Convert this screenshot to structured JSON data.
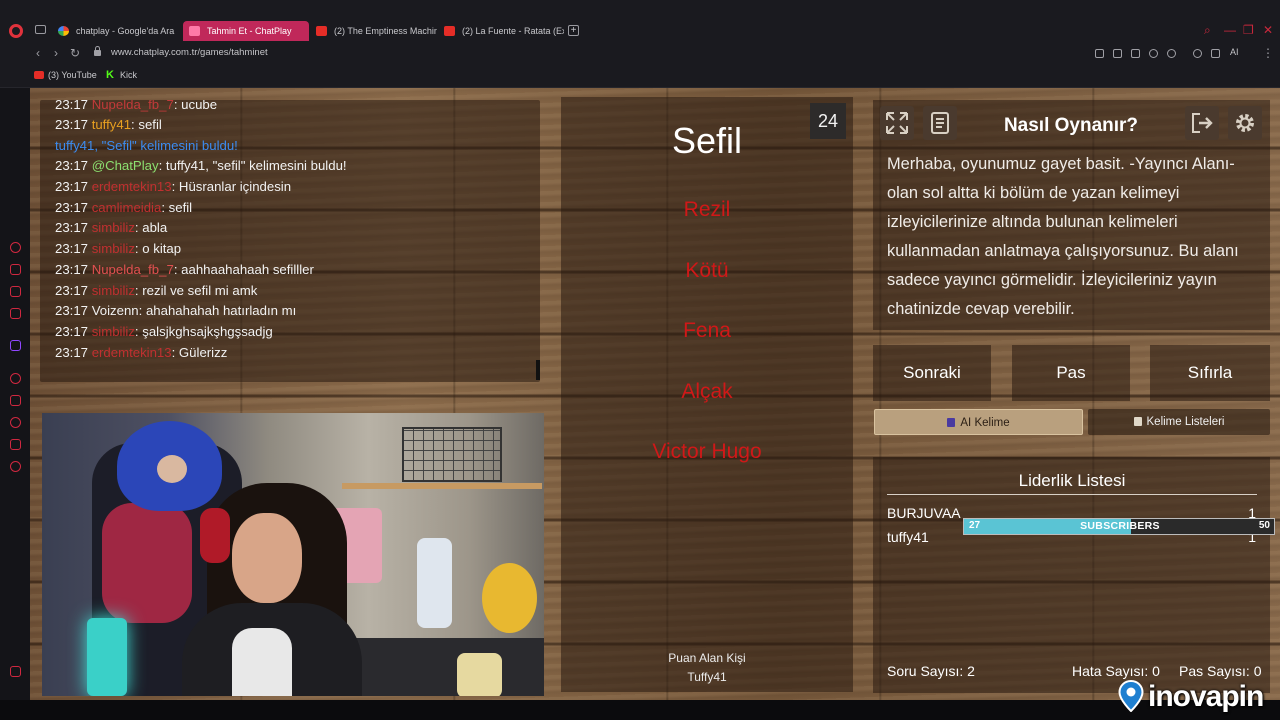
{
  "browser": {
    "tabs": [
      {
        "label": "chatplay - Google'da Ara",
        "favicon": "google-icon",
        "active": false
      },
      {
        "label": "Tahmin Et - ChatPlay",
        "favicon": "chatplay-icon",
        "active": true
      },
      {
        "label": "(2) The Emptiness Machin",
        "favicon": "youtube-icon",
        "active": false
      },
      {
        "label": "(2) La Fuente - Ratata (Ext",
        "favicon": "youtube-icon",
        "active": false
      }
    ],
    "new_tab": "+",
    "url": "www.chatplay.com.tr/games/tahminet",
    "ai_label": "AI",
    "bookmarks": [
      {
        "label": "(3) YouTube"
      },
      {
        "label": "Kick"
      }
    ],
    "colors": {
      "active_tab": "#c0285a",
      "sidebar_accent": "#d02840"
    }
  },
  "chat": {
    "messages": [
      {
        "time": "23:17",
        "user": "Nupelda_fb_7",
        "sep": ": ",
        "text": "ucube",
        "user_color": "#c23a3a"
      },
      {
        "time": "23:17",
        "user": "tuffy41",
        "sep": ": ",
        "text": "sefil",
        "user_color": "#e8a020"
      },
      {
        "time": "",
        "user": "",
        "sep": "",
        "text": "tuffy41, \"Sefil\" kelimesini buldu!",
        "user_color": "#3c8cf0",
        "text_color": "#3c8cf0"
      },
      {
        "time": "23:17",
        "user": "@ChatPlay",
        "sep": ": ",
        "text": "tuffy41, \"sefil\" kelimesini buldu!",
        "user_color": "#8ce070"
      },
      {
        "time": "23:17",
        "user": "erdemtekin13",
        "sep": ": ",
        "text": "Hüsranlar içindesin",
        "user_color": "#c03030"
      },
      {
        "time": "23:17",
        "user": "camlimeidia",
        "sep": ": ",
        "text": "sefil",
        "user_color": "#c03030"
      },
      {
        "time": "23:17",
        "user": "simbiliz",
        "sep": ": ",
        "text": "abla",
        "user_color": "#c03030"
      },
      {
        "time": "23:17",
        "user": "simbiliz",
        "sep": ": ",
        "text": "o kitap",
        "user_color": "#c03030"
      },
      {
        "time": "23:17",
        "user": "Nupelda_fb_7",
        "sep": ": ",
        "text": "aahhaahahaah sefilller",
        "user_color": "#e05050"
      },
      {
        "time": "23:17",
        "user": "simbiliz",
        "sep": ": ",
        "text": "rezil ve sefil mi amk",
        "user_color": "#c03030"
      },
      {
        "time": "23:17",
        "user": "Voizenn",
        "sep": ": ",
        "text": "ahahahahah hatırladın mı",
        "user_color": "#f0f0f0"
      },
      {
        "time": "23:17",
        "user": "simbiliz",
        "sep": ": ",
        "text": "şalsjkghsajkşhgşsadjg",
        "user_color": "#c03030"
      },
      {
        "time": "23:17",
        "user": "erdemtekin13",
        "sep": ": ",
        "text": "Gülerizz",
        "user_color": "#c03030"
      }
    ]
  },
  "game": {
    "timer": "24",
    "word": "Sefil",
    "forbidden": [
      "Rezil",
      "Kötü",
      "Fena",
      "Alçak",
      "Victor Hugo"
    ],
    "scorer_label": "Puan Alan Kişi",
    "scorer_name": "Tuffy41",
    "forbidden_color": "#d01818"
  },
  "help": {
    "title": "Nasıl Oynanır?",
    "text": "Merhaba, oyunumuz gayet basit. -Yayıncı Alanı- olan sol altta ki bölüm de yazan kelimeyi izleyicilerinize altında bulunan kelimeleri kullanmadan anlatmaya çalışıyorsunuz. Bu alanı sadece yayıncı görmelidir. İzleyicileriniz yayın chatinizde cevap verebilir."
  },
  "controls": {
    "next": "Sonraki",
    "pass": "Pas",
    "reset": "Sıfırla",
    "ai_word": "AI Kelime",
    "word_lists": "Kelime Listeleri"
  },
  "leaderboard": {
    "title": "Liderlik Listesi",
    "rows": [
      {
        "name": "BURJUVAA",
        "score": "1"
      },
      {
        "name": "tuffy41",
        "score": "1"
      }
    ],
    "question_count": "Soru Sayısı: 2",
    "error_count": "Hata Sayısı: 0",
    "pass_count": "Pas Sayısı: 0"
  },
  "overlay": {
    "current": "27",
    "label": "SUBSCRIBERS",
    "goal": "50",
    "progress": 0.54,
    "fill_color": "#5ac4d4"
  },
  "watermark": {
    "text": "inovapin"
  }
}
